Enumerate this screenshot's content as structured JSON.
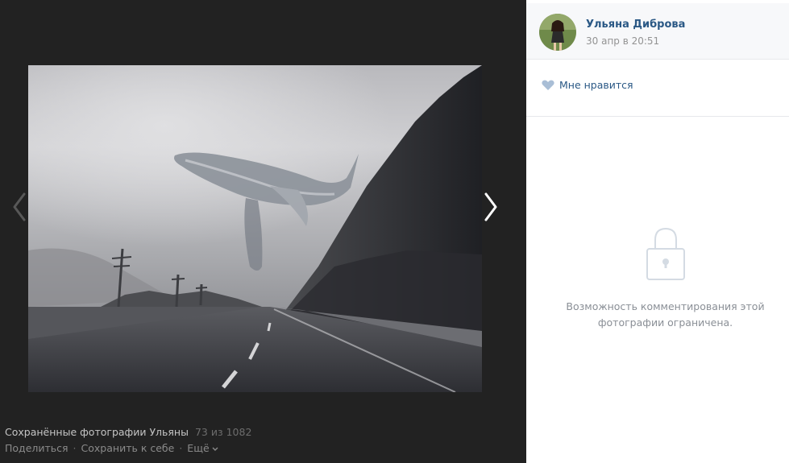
{
  "viewer": {
    "album_title": "Сохранённые фотографии Ульяны",
    "counter": "73 из 1082",
    "actions": {
      "share": "Поделиться",
      "save": "Сохранить к себе",
      "more": "Ещё",
      "separator": "·"
    },
    "photo": {
      "subject": "whale-floating-over-foggy-forest-highway"
    },
    "arrows": {
      "prev_icon": "chevron-left-icon",
      "next_icon": "chevron-right-icon"
    }
  },
  "sidebar": {
    "author": {
      "name": "Ульяна Диброва",
      "date": "30 апр в 20:51"
    },
    "like": {
      "label": "Мне нравится",
      "icon": "heart-icon"
    },
    "comments": {
      "icon": "lock-icon",
      "restricted_text": "Возможность комментирования этой фотографии ограничена."
    }
  },
  "colors": {
    "viewer_bg": "#222222",
    "link": "#2a5885",
    "muted": "#939393",
    "sidebar_bg": "#ffffff"
  }
}
